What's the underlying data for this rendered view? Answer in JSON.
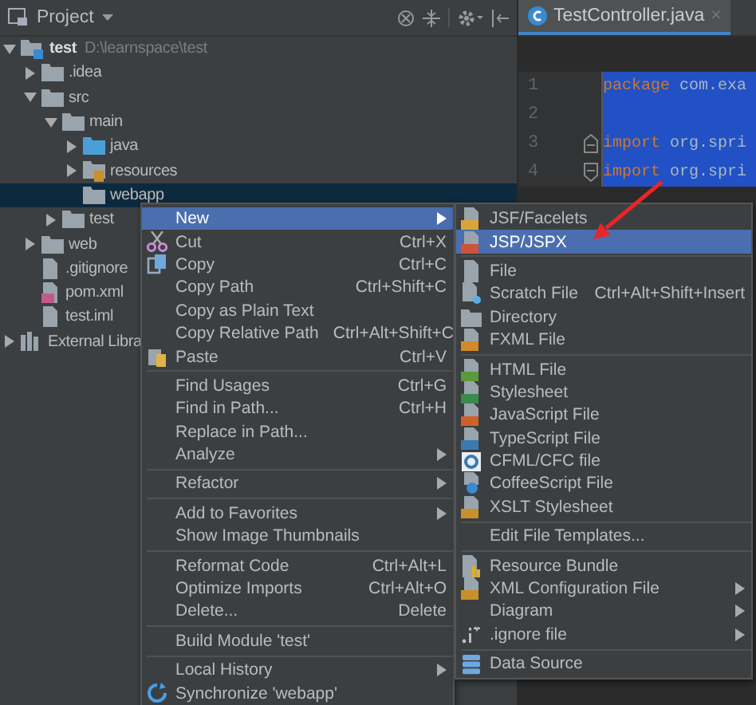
{
  "project_panel": {
    "title": "Project",
    "tree": [
      {
        "label": "test",
        "path": "D:\\learnspace\\test",
        "kind": "module",
        "expanded": true,
        "selected": false,
        "children": [
          {
            "label": ".idea",
            "kind": "folder",
            "expanded": false,
            "selected": false
          },
          {
            "label": "src",
            "kind": "folder",
            "expanded": true,
            "selected": false,
            "children": [
              {
                "label": "main",
                "kind": "folder",
                "expanded": true,
                "selected": false,
                "children": [
                  {
                    "label": "java",
                    "kind": "source",
                    "expanded": false,
                    "selected": false
                  },
                  {
                    "label": "resources",
                    "kind": "resources",
                    "expanded": false,
                    "selected": false
                  },
                  {
                    "label": "webapp",
                    "kind": "folder",
                    "selected": true
                  }
                ]
              },
              {
                "label": "test",
                "kind": "folder",
                "expanded": false,
                "selected": false
              }
            ]
          },
          {
            "label": "web",
            "kind": "folder",
            "expanded": false,
            "selected": false
          },
          {
            "label": ".gitignore",
            "kind": "file",
            "selected": false
          },
          {
            "label": "pom.xml",
            "kind": "maven",
            "selected": false
          },
          {
            "label": "test.iml",
            "kind": "file",
            "selected": false
          }
        ]
      },
      {
        "label": "External Libra",
        "kind": "library",
        "expanded": false,
        "selected": false
      }
    ]
  },
  "editor": {
    "tab": {
      "label": "TestController.java",
      "close": "×"
    },
    "lines": [
      {
        "number": "1",
        "selected": true,
        "code": [
          {
            "kind": "keyword",
            "text": "package"
          },
          {
            "kind": "plain",
            "text": " com.exa"
          }
        ]
      },
      {
        "number": "2",
        "selected": true
      },
      {
        "number": "3",
        "selected": true,
        "code": [
          {
            "kind": "keyword",
            "text": "import"
          },
          {
            "kind": "plain",
            "text": " org.spri"
          }
        ]
      },
      {
        "number": "4",
        "selected": true,
        "code": [
          {
            "kind": "keyword",
            "text": "import"
          },
          {
            "kind": "plain",
            "text": " org.spri"
          }
        ]
      }
    ]
  },
  "context_menu": {
    "items": [
      {
        "kind": "item",
        "label": "New",
        "submenu": true,
        "selected": true
      },
      {
        "kind": "item",
        "label": "Cut",
        "shortcut": "Ctrl+X",
        "selected": false
      },
      {
        "kind": "item",
        "label": "Copy",
        "shortcut": "Ctrl+C",
        "selected": false
      },
      {
        "kind": "item",
        "label": "Copy Path",
        "shortcut": "Ctrl+Shift+C",
        "selected": false
      },
      {
        "kind": "item",
        "label": "Copy as Plain Text",
        "selected": false
      },
      {
        "kind": "item",
        "label": "Copy Relative Path",
        "shortcut": "Ctrl+Alt+Shift+C",
        "selected": false
      },
      {
        "kind": "item",
        "label": "Paste",
        "shortcut": "Ctrl+V",
        "selected": false
      },
      {
        "kind": "separator"
      },
      {
        "kind": "item",
        "label": "Find Usages",
        "shortcut": "Ctrl+G",
        "selected": false
      },
      {
        "kind": "item",
        "label": "Find in Path...",
        "shortcut": "Ctrl+H",
        "selected": false
      },
      {
        "kind": "item",
        "label": "Replace in Path...",
        "selected": false
      },
      {
        "kind": "item",
        "label": "Analyze",
        "submenu": true,
        "selected": false
      },
      {
        "kind": "separator"
      },
      {
        "kind": "item",
        "label": "Refactor",
        "submenu": true,
        "selected": false
      },
      {
        "kind": "separator"
      },
      {
        "kind": "item",
        "label": "Add to Favorites",
        "submenu": true,
        "selected": false
      },
      {
        "kind": "item",
        "label": "Show Image Thumbnails",
        "selected": false
      },
      {
        "kind": "separator"
      },
      {
        "kind": "item",
        "label": "Reformat Code",
        "shortcut": "Ctrl+Alt+L",
        "selected": false
      },
      {
        "kind": "item",
        "label": "Optimize Imports",
        "shortcut": "Ctrl+Alt+O",
        "selected": false
      },
      {
        "kind": "item",
        "label": "Delete...",
        "shortcut": "Delete",
        "selected": false
      },
      {
        "kind": "separator"
      },
      {
        "kind": "item",
        "label": "Build Module 'test'",
        "selected": false
      },
      {
        "kind": "separator"
      },
      {
        "kind": "item",
        "label": "Local History",
        "submenu": true,
        "selected": false
      },
      {
        "kind": "item",
        "label": "Synchronize 'webapp'",
        "selected": false
      }
    ]
  },
  "new_submenu": {
    "items": [
      {
        "kind": "item",
        "label": "JSF/Facelets",
        "selected": false
      },
      {
        "kind": "item",
        "label": "JSP/JSPX",
        "selected": true
      },
      {
        "kind": "separator"
      },
      {
        "kind": "item",
        "label": "File",
        "selected": false
      },
      {
        "kind": "item",
        "label": "Scratch File",
        "shortcut": "Ctrl+Alt+Shift+Insert",
        "selected": false
      },
      {
        "kind": "item",
        "label": "Directory",
        "selected": false
      },
      {
        "kind": "item",
        "label": "FXML File",
        "selected": false
      },
      {
        "kind": "separator"
      },
      {
        "kind": "item",
        "label": "HTML File",
        "selected": false
      },
      {
        "kind": "item",
        "label": "Stylesheet",
        "selected": false
      },
      {
        "kind": "item",
        "label": "JavaScript File",
        "selected": false
      },
      {
        "kind": "item",
        "label": "TypeScript File",
        "selected": false
      },
      {
        "kind": "item",
        "label": "CFML/CFC file",
        "selected": false
      },
      {
        "kind": "item",
        "label": "CoffeeScript File",
        "selected": false
      },
      {
        "kind": "item",
        "label": "XSLT Stylesheet",
        "selected": false
      },
      {
        "kind": "separator"
      },
      {
        "kind": "item",
        "label": "Edit File Templates...",
        "selected": false
      },
      {
        "kind": "separator"
      },
      {
        "kind": "item",
        "label": "Resource Bundle",
        "selected": false
      },
      {
        "kind": "item",
        "label": "XML Configuration File",
        "submenu": true,
        "selected": false
      },
      {
        "kind": "item",
        "label": "Diagram",
        "submenu": true,
        "selected": false
      },
      {
        "kind": "item",
        "label": ".ignore file",
        "submenu": true,
        "selected": false
      },
      {
        "kind": "separator"
      },
      {
        "kind": "item",
        "label": "Data Source",
        "selected": false
      }
    ]
  }
}
